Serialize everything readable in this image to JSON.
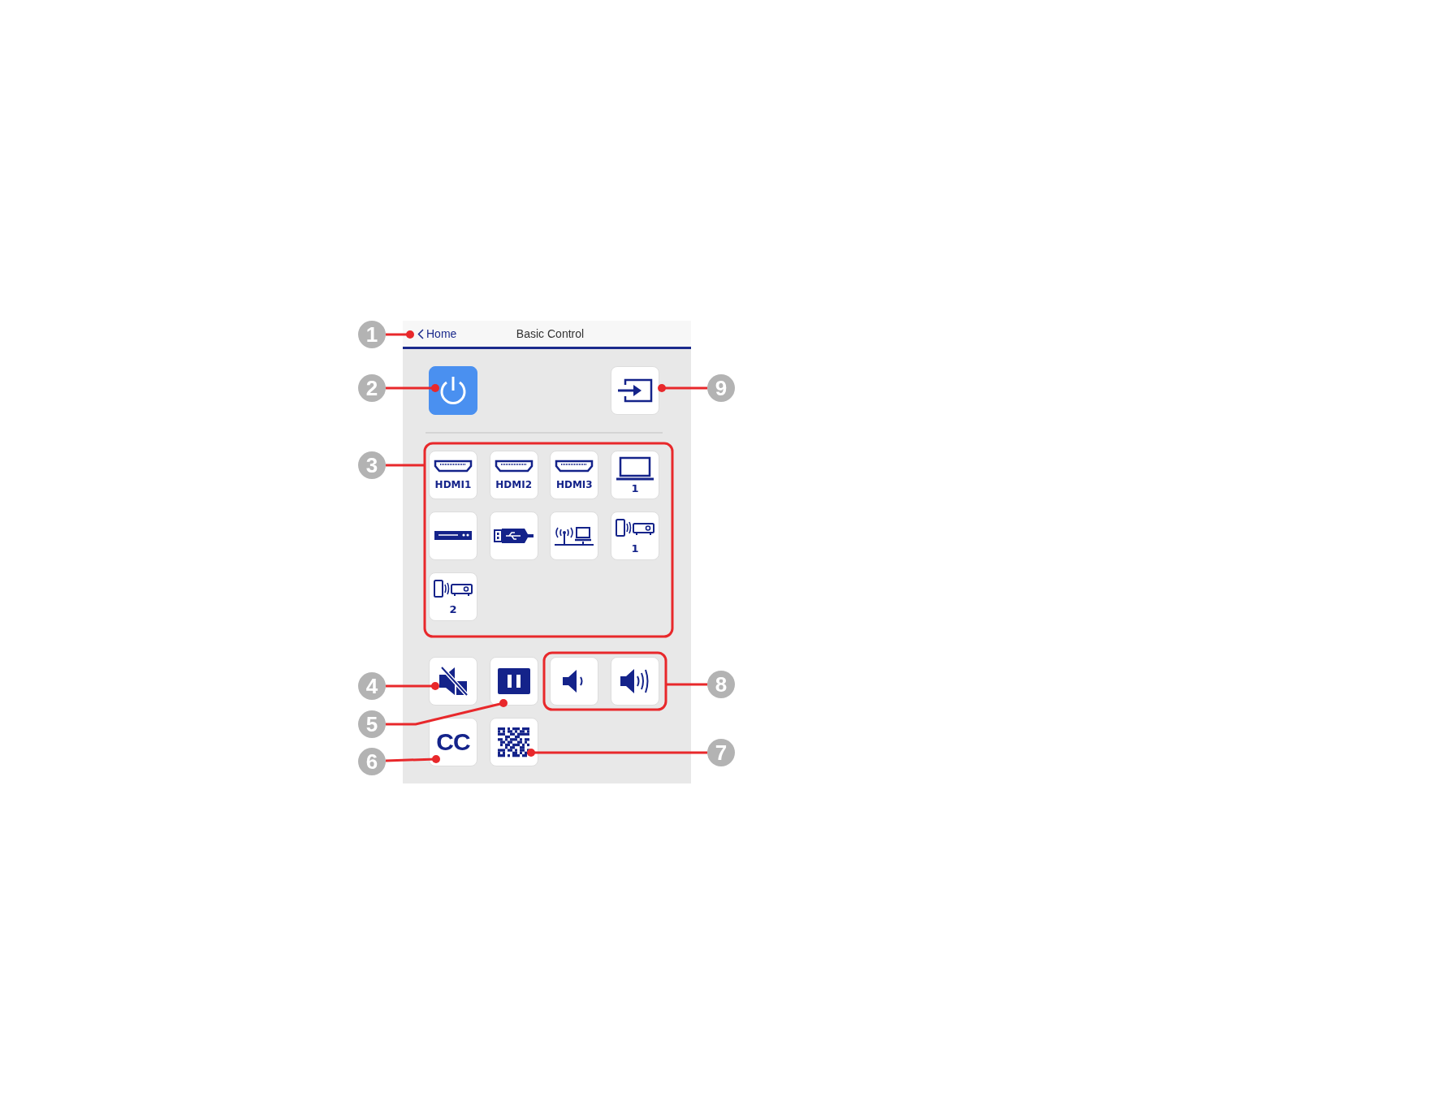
{
  "header": {
    "back_label": "Home",
    "title": "Basic Control"
  },
  "power": {
    "on": true
  },
  "input_button": {
    "kind": "input"
  },
  "sources": [
    {
      "kind": "hdmi",
      "label": "HDMI1"
    },
    {
      "kind": "hdmi",
      "label": "HDMI2"
    },
    {
      "kind": "hdmi",
      "label": "HDMI3"
    },
    {
      "kind": "computer",
      "label": "1"
    },
    {
      "kind": "video"
    },
    {
      "kind": "usb"
    },
    {
      "kind": "network"
    },
    {
      "kind": "mirroring",
      "label": "1"
    },
    {
      "kind": "mirroring",
      "label": "2"
    }
  ],
  "controls": [
    {
      "kind": "mute"
    },
    {
      "kind": "pause"
    },
    {
      "kind": "volume_down"
    },
    {
      "kind": "volume_up"
    },
    {
      "kind": "cc",
      "label": "CC"
    },
    {
      "kind": "qr"
    }
  ],
  "callouts": [
    {
      "number": "1"
    },
    {
      "number": "2"
    },
    {
      "number": "3"
    },
    {
      "number": "4"
    },
    {
      "number": "5"
    },
    {
      "number": "6"
    },
    {
      "number": "9"
    },
    {
      "number": "8"
    },
    {
      "number": "7"
    }
  ]
}
